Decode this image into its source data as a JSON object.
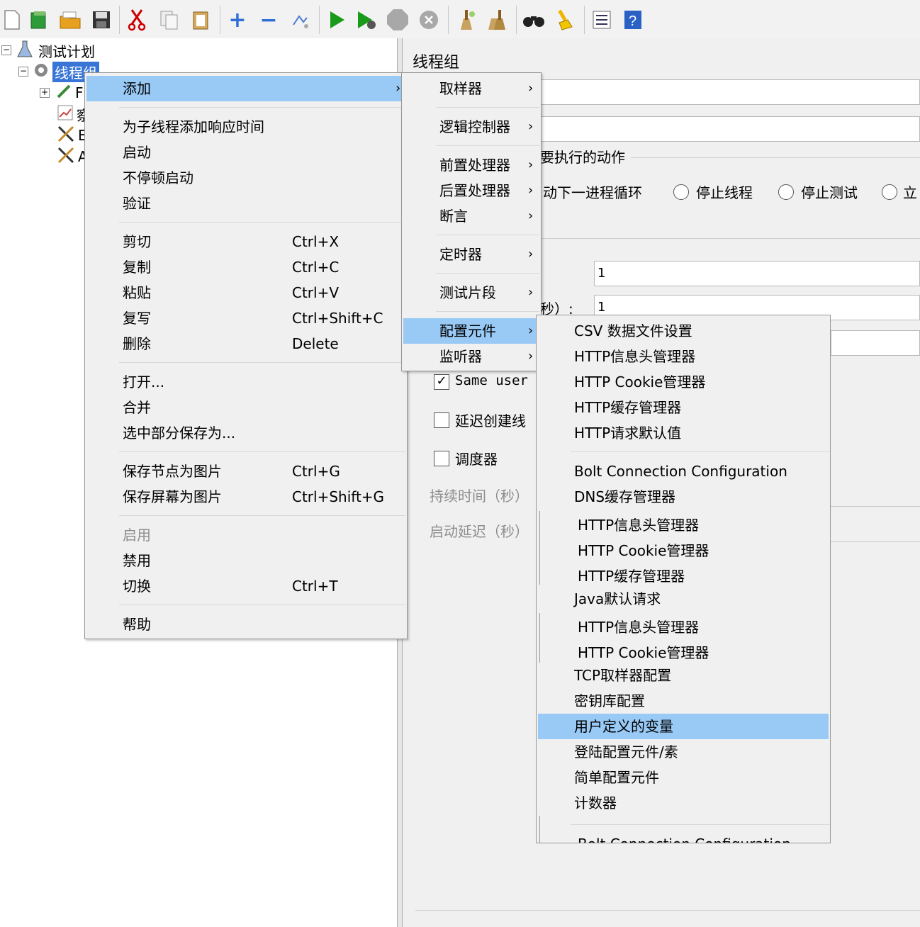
{
  "tree": {
    "root": "测试计划",
    "thread_group": "线程组",
    "child_initials": [
      "F",
      "察",
      "E",
      "A"
    ]
  },
  "right_panel": {
    "title": "线程组",
    "error_action_fragment": "要执行的动作",
    "radio_next_loop": "动下一进程循环",
    "radio_stop_thread": "停止线程",
    "radio_stop_test": "停止测试",
    "radio_stop_now": "立",
    "ramp_label_fragment": "秒）:",
    "threads_value": "1",
    "ramp_value": "1",
    "same_user_label": "Same user",
    "delay_create_label": "延迟创建线",
    "scheduler_label": "调度器",
    "duration_label": "持续时间（秒）",
    "startup_delay_label": "启动延迟（秒）"
  },
  "menu1": {
    "items": [
      {
        "label": "添加",
        "shortcut": "",
        "submenu": true
      },
      {
        "label": "为子线程添加响应时间",
        "shortcut": ""
      },
      {
        "label": "启动",
        "shortcut": ""
      },
      {
        "label": "不停顿启动",
        "shortcut": ""
      },
      {
        "label": "验证",
        "shortcut": ""
      },
      {
        "label": "剪切",
        "shortcut": "Ctrl+X"
      },
      {
        "label": "复制",
        "shortcut": "Ctrl+C"
      },
      {
        "label": "粘贴",
        "shortcut": "Ctrl+V"
      },
      {
        "label": "复写",
        "shortcut": "Ctrl+Shift+C"
      },
      {
        "label": "删除",
        "shortcut": "Delete"
      },
      {
        "label": "打开...",
        "shortcut": ""
      },
      {
        "label": "合并",
        "shortcut": ""
      },
      {
        "label": "选中部分保存为...",
        "shortcut": ""
      },
      {
        "label": "保存节点为图片",
        "shortcut": "Ctrl+G"
      },
      {
        "label": "保存屏幕为图片",
        "shortcut": "Ctrl+Shift+G"
      },
      {
        "label": "启用",
        "shortcut": ""
      },
      {
        "label": "禁用",
        "shortcut": ""
      },
      {
        "label": "切换",
        "shortcut": "Ctrl+T"
      },
      {
        "label": "帮助",
        "shortcut": ""
      }
    ]
  },
  "menu2": {
    "items": [
      "取样器",
      "逻辑控制器",
      "前置处理器",
      "后置处理器",
      "断言",
      "定时器",
      "测试片段",
      "配置元件",
      "监听器"
    ]
  },
  "menu3": {
    "items": [
      "CSV 数据文件设置",
      "HTTP信息头管理器",
      "HTTP Cookie管理器",
      "HTTP缓存管理器",
      "HTTP请求默认值",
      "Bolt Connection Configuration",
      "DNS缓存管理器",
      "HTTP信息头管理器",
      "HTTP Cookie管理器",
      "HTTP缓存管理器",
      "Java默认请求",
      "HTTP信息头管理器",
      "HTTP Cookie管理器",
      "TCP取样器配置",
      "密钥库配置",
      "用户定义的变量",
      "登陆配置元件/素",
      "简单配置元件",
      "计数器",
      "Bolt Connection Configuration"
    ]
  },
  "colors": {
    "selection": "#99c9f5",
    "tree_selection": "#3875d7",
    "menu_bg": "#f0f0f0",
    "run_green": "#1a9a1a"
  },
  "icons": [
    "new-file-icon",
    "template-icon",
    "open-icon",
    "save-icon",
    "cut-icon",
    "copy-icon",
    "paste-icon",
    "expand-icon",
    "collapse-icon",
    "toggle-icon",
    "start-icon",
    "start-no-pause-icon",
    "stop-icon",
    "shutdown-icon",
    "clear-icon",
    "clear-all-icon",
    "search-icon",
    "reset-search-icon",
    "function-helper-icon",
    "help-icon"
  ]
}
